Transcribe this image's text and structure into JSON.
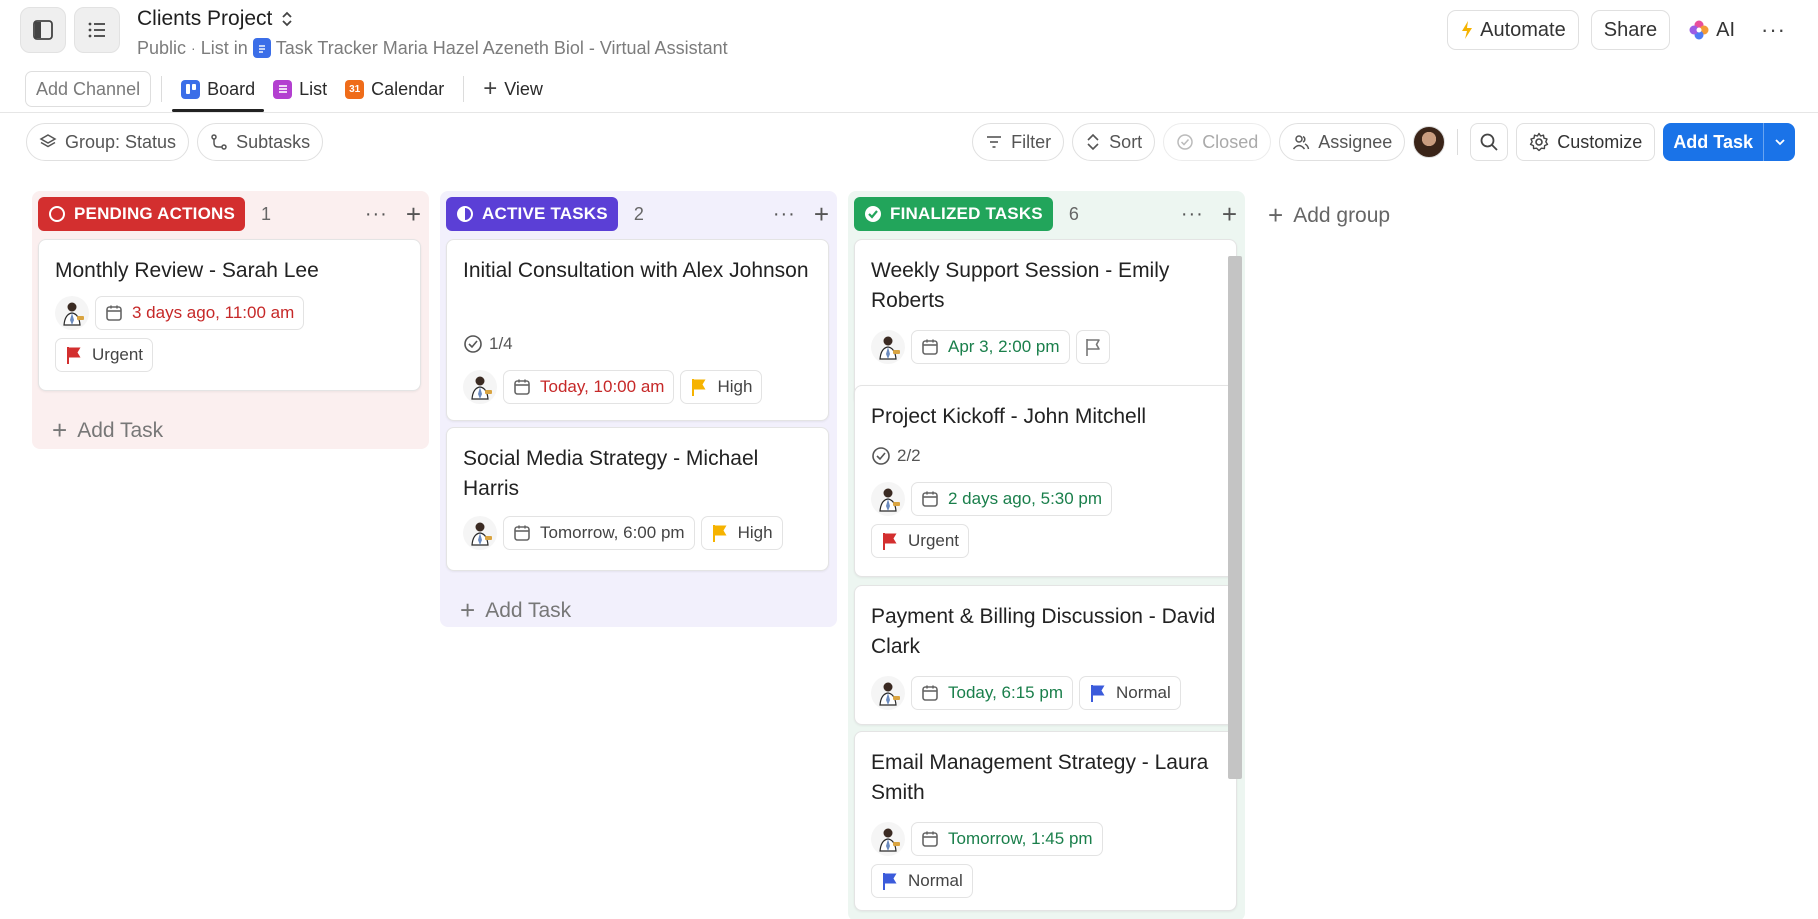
{
  "header": {
    "title": "Clients Project",
    "visibility": "Public",
    "list_in_label": "List in",
    "breadcrumb_space": "Task Tracker Maria Hazel Azeneth Biol - Virtual Assistant",
    "automate": "Automate",
    "share": "Share",
    "ai": "AI"
  },
  "views": {
    "add_channel": "Add Channel",
    "tabs": [
      {
        "label": "Board",
        "active": true,
        "icon": "board-icon"
      },
      {
        "label": "List",
        "active": false,
        "icon": "list-icon"
      },
      {
        "label": "Calendar",
        "active": false,
        "icon": "calendar-icon",
        "icon_text": "31"
      }
    ],
    "add_view": "View"
  },
  "toolbar": {
    "group": "Group: Status",
    "subtasks": "Subtasks",
    "filter": "Filter",
    "sort": "Sort",
    "closed": "Closed",
    "assignee": "Assignee",
    "customize": "Customize",
    "add_task": "Add Task"
  },
  "columns": [
    {
      "status": "PENDING ACTIONS",
      "count": "1",
      "color": "#d32f2f",
      "bg": "#fbefef",
      "add_task": "Add Task",
      "cards": [
        {
          "title": "Monthly Review - Sarah Lee",
          "date": "3 days ago, 11:00 am",
          "date_color": "red",
          "priority": "Urgent",
          "priority_color": "#d32f2f"
        }
      ]
    },
    {
      "status": "ACTIVE TASKS",
      "count": "2",
      "color": "#5b3fd6",
      "bg": "#f2f0fc",
      "add_task": "Add Task",
      "cards": [
        {
          "title": "Initial Consultation with Alex Johnson",
          "subtasks": "1/4",
          "date": "Today, 10:00 am",
          "date_color": "red",
          "priority": "High",
          "priority_color": "#f6b300"
        },
        {
          "title": "Social Media Strategy - Michael Harris",
          "date": "Tomorrow, 6:00 pm",
          "date_color": "gray",
          "priority": "High",
          "priority_color": "#f6b300"
        }
      ]
    },
    {
      "status": "FINALIZED TASKS",
      "count": "6",
      "color": "#22a55b",
      "bg": "#edf6f1",
      "cards": [
        {
          "title": "Weekly Support Session - Emily Roberts",
          "date": "Apr 3, 2:00 pm",
          "date_color": "green",
          "priority": "",
          "priority_color": "#888888"
        },
        {
          "title": "Project Kickoff - John Mitchell",
          "subtasks": "2/2",
          "date": "2 days ago, 5:30 pm",
          "date_color": "green",
          "priority": "Urgent",
          "priority_color": "#d32f2f"
        },
        {
          "title": "Payment & Billing Discussion - David Clark",
          "date": "Today, 6:15 pm",
          "date_color": "green",
          "priority": "Normal",
          "priority_color": "#3b5bdb"
        },
        {
          "title": "Email Management Strategy - Laura Smith",
          "date": "Tomorrow, 1:45 pm",
          "date_color": "green",
          "priority": "Normal",
          "priority_color": "#3b5bdb"
        }
      ]
    }
  ],
  "add_group": "Add group"
}
